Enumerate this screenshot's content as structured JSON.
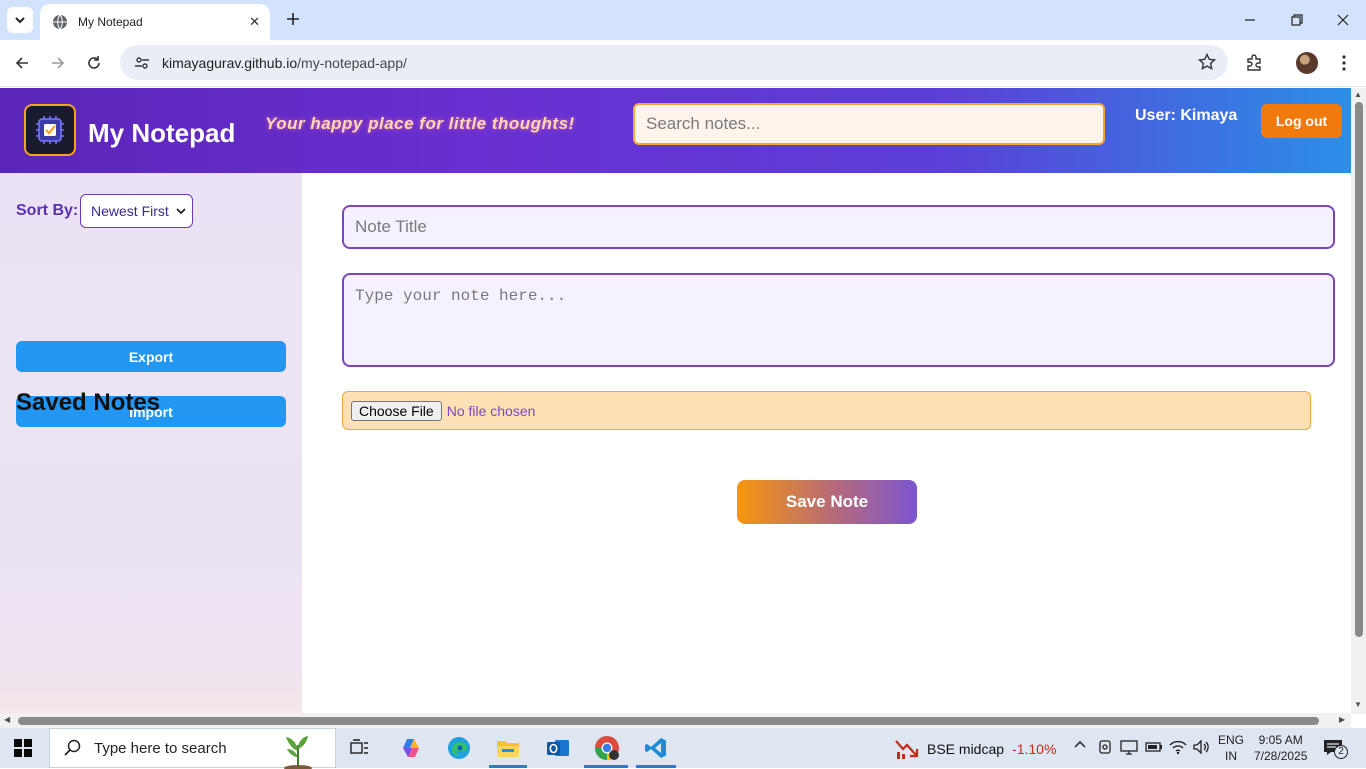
{
  "browser": {
    "tab_title": "My Notepad",
    "url_host": "kimayagurav.github.io",
    "url_path": "/my-notepad-app/"
  },
  "header": {
    "app_title": "My Notepad",
    "tagline": "Your happy place for little thoughts!",
    "search_placeholder": "Search notes...",
    "user_label": "User: Kimaya",
    "logout_label": "Log out"
  },
  "sidebar": {
    "sort_label": "Sort By:",
    "sort_selected": "Newest First",
    "export_label": "Export",
    "import_label": "Import",
    "saved_notes_heading": "Saved Notes"
  },
  "editor": {
    "title_placeholder": "Note Title",
    "body_placeholder": "Type your note here...",
    "file_button_label": "Choose File",
    "file_status": "No file chosen",
    "save_label": "Save Note"
  },
  "taskbar": {
    "search_placeholder": "Type here to search",
    "stock_name": "BSE midcap",
    "stock_change": "-1.10%",
    "lang_top": "ENG",
    "lang_bottom": "IN",
    "time": "9:05 AM",
    "date": "7/28/2025",
    "notification_count": "2"
  },
  "colors": {
    "header_start": "#5a25b8",
    "header_end": "#2b8fe8",
    "accent_orange": "#f07a0c",
    "button_blue": "#2196f3",
    "input_border_purple": "#7a47b8"
  }
}
